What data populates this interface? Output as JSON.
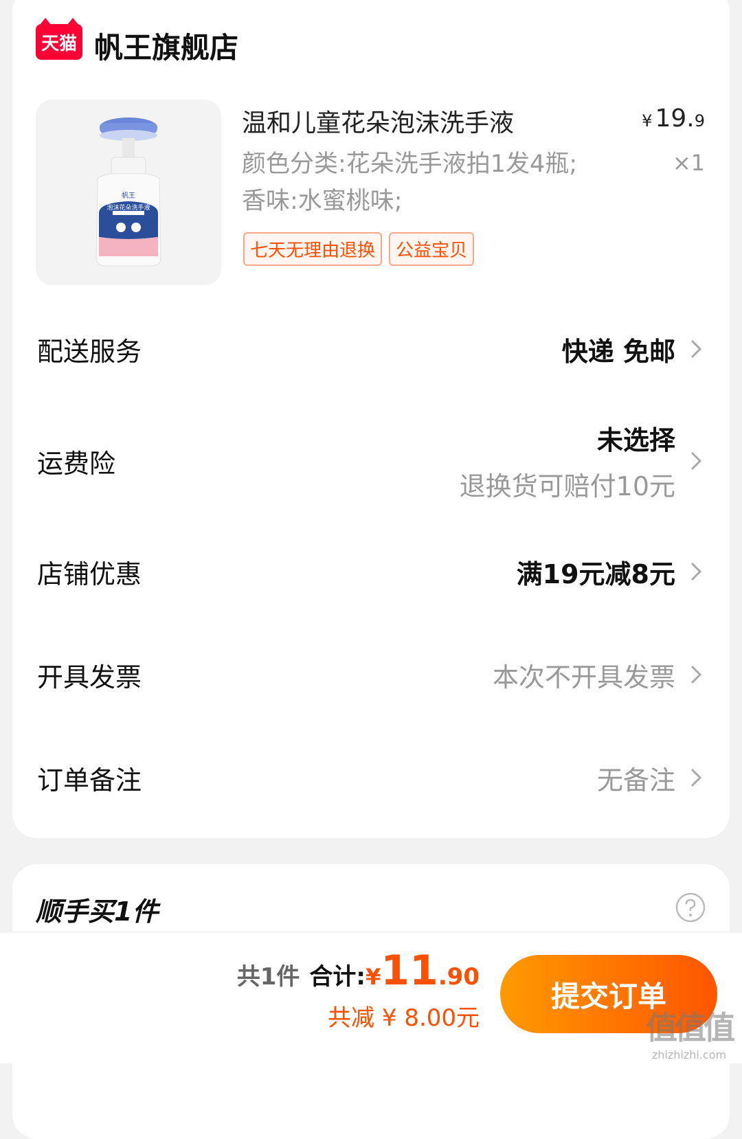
{
  "store": {
    "badge": "天猫",
    "name": "帆王旗舰店"
  },
  "product": {
    "title": "温和儿童花朵泡沫洗手液",
    "sku": "颜色分类:花朵洗手液拍1发4瓶;香味:水蜜桃味;",
    "price_symbol": "¥",
    "price_int": "19.",
    "price_dec": "9",
    "quantity": "×1",
    "tags": [
      "七天无理由退换",
      "公益宝贝"
    ],
    "image": {
      "brand": "帆王",
      "label": "泡沫花朵洗手液"
    }
  },
  "rows": {
    "delivery": {
      "label": "配送服务",
      "value": "快递 免邮"
    },
    "insurance": {
      "label": "运费险",
      "value": "未选择",
      "sub": "退换货可赔付10元"
    },
    "discount": {
      "label": "店铺优惠",
      "value": "满19元减8元"
    },
    "invoice": {
      "label": "开具发票",
      "value": "本次不开具发票"
    },
    "note": {
      "label": "订单备注",
      "value": "无备注"
    }
  },
  "addon": {
    "title": "顺手买1件"
  },
  "summary": {
    "count": "共1件",
    "total_label": "合计:",
    "total_symbol": "¥",
    "total_int": "11",
    "total_dec": ".90",
    "discount_text": "共减 ¥ 8.00元",
    "submit": "提交订单"
  },
  "watermark": {
    "main": "值值值",
    "sub": "zhizhizhi.com"
  },
  "colors": {
    "accent": "#ff5000",
    "tmall_red": "#ff0036",
    "button_start": "#ff9a00",
    "button_end": "#ff5500"
  }
}
